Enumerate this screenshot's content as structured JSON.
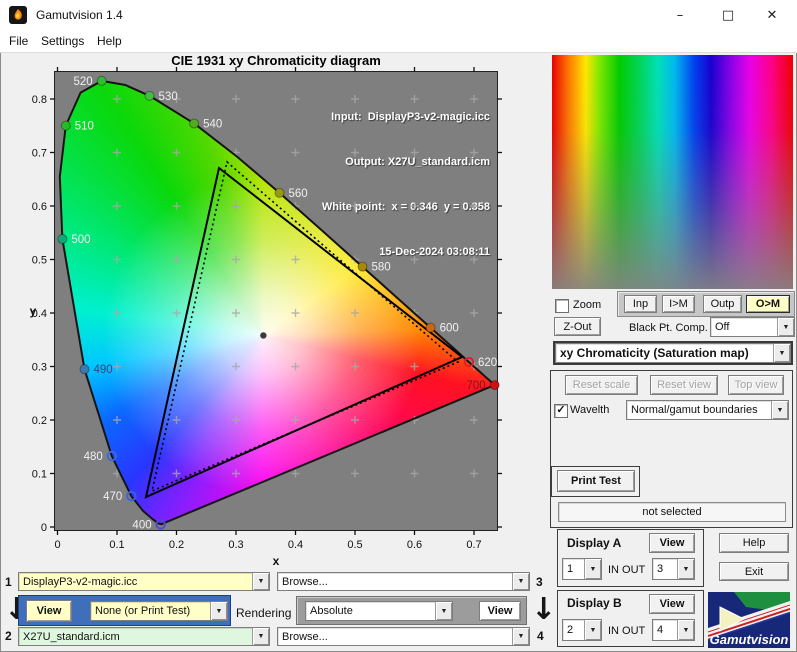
{
  "window": {
    "title": "Gamutvision 1.4"
  },
  "titlebar_controls": {
    "minimize": "–",
    "maximize": "□",
    "close": "✕"
  },
  "menu": [
    "File",
    "Settings",
    "Help"
  ],
  "figure": {
    "title": "CIE 1931 xy Chromaticity diagram",
    "info_lines": [
      "Input:  DisplayP3-v2-magic.icc",
      "Output: X27U_standard.icm",
      "White point:  x = 0.346  y = 0.358",
      "15-Dec-2024 03:08:11"
    ]
  },
  "chart_data": {
    "type": "scatter",
    "title": "CIE 1931 xy Chromaticity diagram",
    "xlabel": "x",
    "ylabel": "y",
    "xlim": [
      0,
      0.743
    ],
    "ylim": [
      0,
      0.851
    ],
    "x_ticks": [
      0,
      0.1,
      0.2,
      0.3,
      0.4,
      0.5,
      0.6,
      0.7
    ],
    "y_ticks": [
      0,
      0.1,
      0.2,
      0.3,
      0.4,
      0.5,
      0.6,
      0.7,
      0.8
    ],
    "grid_cross_color": "#a8a8a8",
    "white_point": {
      "x": 0.346,
      "y": 0.358
    },
    "spectral_locus": [
      [
        380,
        0.1741,
        0.005
      ],
      [
        430,
        0.1689,
        0.0069
      ],
      [
        440,
        0.1644,
        0.0109
      ],
      [
        450,
        0.1566,
        0.0177
      ],
      [
        460,
        0.144,
        0.0297
      ],
      [
        470,
        0.1241,
        0.0578
      ],
      [
        480,
        0.0913,
        0.1327
      ],
      [
        490,
        0.0454,
        0.295
      ],
      [
        500,
        0.0082,
        0.5384
      ],
      [
        505,
        0.0039,
        0.6548
      ],
      [
        510,
        0.0139,
        0.7502
      ],
      [
        515,
        0.0389,
        0.812
      ],
      [
        520,
        0.0743,
        0.8338
      ],
      [
        525,
        0.1142,
        0.8262
      ],
      [
        530,
        0.1547,
        0.8059
      ],
      [
        540,
        0.2296,
        0.7543
      ],
      [
        550,
        0.3016,
        0.6923
      ],
      [
        560,
        0.3731,
        0.6245
      ],
      [
        570,
        0.4441,
        0.5547
      ],
      [
        580,
        0.5125,
        0.4866
      ],
      [
        590,
        0.5752,
        0.4242
      ],
      [
        600,
        0.627,
        0.3725
      ],
      [
        610,
        0.6658,
        0.334
      ],
      [
        620,
        0.6915,
        0.3083
      ],
      [
        630,
        0.7079,
        0.292
      ],
      [
        640,
        0.719,
        0.2809
      ],
      [
        650,
        0.726,
        0.274
      ],
      [
        700,
        0.7347,
        0.2653
      ]
    ],
    "wavelength_labels": [
      {
        "nm": "400",
        "x": 0.1733,
        "y": 0.0048,
        "side": "left",
        "label_color": "#f0f0f0",
        "marker": "#4a4ad0",
        "open": true
      },
      {
        "nm": "470",
        "x": 0.1241,
        "y": 0.0578,
        "side": "left",
        "label_color": "#f0f0f0",
        "marker": "#3a62d8",
        "open": true
      },
      {
        "nm": "480",
        "x": 0.0913,
        "y": 0.1327,
        "side": "left",
        "label_color": "#f0f0f0",
        "marker": "#3a6ad8",
        "open": true
      },
      {
        "nm": "490",
        "x": 0.0454,
        "y": 0.295,
        "side": "right",
        "label_color": "#2e4a78",
        "marker": "#3a7ab0",
        "open": false
      },
      {
        "nm": "500",
        "x": 0.0082,
        "y": 0.5384,
        "side": "right",
        "label_color": "#f0f0f0",
        "marker": "#10a878",
        "open": false
      },
      {
        "nm": "510",
        "x": 0.0139,
        "y": 0.7502,
        "side": "right",
        "label_color": "#f0f0f0",
        "marker": "#28b828",
        "open": false
      },
      {
        "nm": "520",
        "x": 0.0743,
        "y": 0.8338,
        "side": "left",
        "label_color": "#f0f0f0",
        "marker": "#30bb30",
        "open": false
      },
      {
        "nm": "530",
        "x": 0.1547,
        "y": 0.8059,
        "side": "right",
        "label_color": "#f0f0f0",
        "marker": "#44bb44",
        "open": false
      },
      {
        "nm": "540",
        "x": 0.2296,
        "y": 0.7543,
        "side": "right",
        "label_color": "#f0f0f0",
        "marker": "#55aa22",
        "open": false
      },
      {
        "nm": "560",
        "x": 0.3731,
        "y": 0.6245,
        "side": "right",
        "label_color": "#f0f0f0",
        "marker": "#999911",
        "open": false
      },
      {
        "nm": "580",
        "x": 0.5125,
        "y": 0.4866,
        "side": "right",
        "label_color": "#f0f0f0",
        "marker": "#aa8800",
        "open": false
      },
      {
        "nm": "600",
        "x": 0.627,
        "y": 0.3725,
        "side": "right",
        "label_color": "#f0f0f0",
        "marker": "#cc6611",
        "open": false
      },
      {
        "nm": "620",
        "x": 0.6915,
        "y": 0.3083,
        "side": "right",
        "label_color": "#f0f0f0",
        "marker": "#dd2222",
        "open": true
      },
      {
        "nm": "700",
        "x": 0.7347,
        "y": 0.2653,
        "side": "left",
        "label_color": "#8a1220",
        "marker": "#cc1111",
        "open": false
      }
    ],
    "gamut_triangles": [
      {
        "name": "input gamut (solid)",
        "style": "solid",
        "points": [
          [
            0.2715,
            0.671
          ],
          [
            0.6798,
            0.3178
          ],
          [
            0.1487,
            0.0561
          ]
        ]
      },
      {
        "name": "output gamut (dotted)",
        "style": "dotted",
        "points": [
          [
            0.2849,
            0.6822
          ],
          [
            0.6731,
            0.3084
          ],
          [
            0.1588,
            0.0673
          ]
        ]
      }
    ]
  },
  "right_panel": {
    "zoom_checkbox": {
      "label": "Zoom",
      "checked": false
    },
    "view_buttons": [
      {
        "label": "Inp"
      },
      {
        "label": "I>M"
      },
      {
        "label": "Outp"
      },
      {
        "label": "O>M"
      }
    ],
    "zout_button": "Z-Out",
    "black_pt_comp": {
      "label": "Black Pt. Comp.",
      "value": "Off"
    },
    "display_mode": {
      "value": "xy Chromaticity (Saturation map)"
    },
    "reset_buttons": [
      "Reset scale",
      "Reset view",
      "Top view"
    ],
    "wavelth_checkbox": {
      "label": "Wavelth",
      "checked": true
    },
    "boundaries_dropdown": "Normal/gamut boundaries",
    "print_test_button": "Print Test",
    "status": "not selected",
    "display_a": {
      "label": "Display A",
      "view": "View",
      "in_value": "1",
      "inout_label": "IN  OUT",
      "out_value": "3"
    },
    "display_b": {
      "label": "Display B",
      "view": "View",
      "in_value": "2",
      "inout_label": "IN  OUT",
      "out_value": "4"
    },
    "help_button": "Help",
    "exit_button": "Exit",
    "logo_text": "Gamutvision"
  },
  "bottom": {
    "row1": {
      "index": "1",
      "profile": "DisplayP3-v2-magic.icc",
      "browse": "Browse...",
      "index_right": "3"
    },
    "row2": {
      "view_left": "View",
      "intent_dropdown": "None (or Print Test)",
      "rendering_label": "Rendering",
      "rendering_value": "Absolute",
      "view_right": "View"
    },
    "row3": {
      "index": "2",
      "profile": "X27U_standard.icm",
      "browse": "Browse...",
      "index_right": "4"
    }
  },
  "colors": {
    "pale_yellow": "#ffffc6",
    "pale_green": "#dff7df",
    "blue_panel": "#3f6fbb",
    "gray_panel": "#9c9c9c",
    "plot_bg": "#7f7f7f",
    "accent_active": "#ffffc6"
  }
}
